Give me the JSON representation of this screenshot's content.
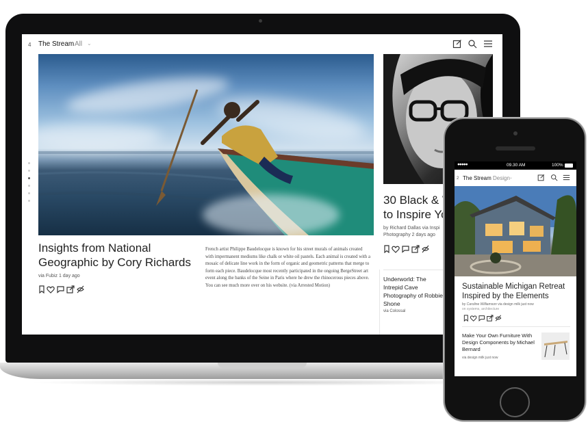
{
  "laptop": {
    "header": {
      "count": "4",
      "title": "The Stream",
      "filter": "All",
      "filter_chevron": "⌄",
      "icons": [
        "compose-icon",
        "search-icon",
        "menu-icon"
      ]
    },
    "pager": {
      "total_dots": 6,
      "active_index": 2
    },
    "featured": {
      "title": "Insights from National Geographic by Cory Richards",
      "meta": "via Fubiz 1 day ago",
      "body": "French artist Philippe Baudelocque is known for his street murals of animals created with impermanent mediums like chalk or white oil pastels. Each animal is created with a mosaic of delicate line work in the form of organic and geometric patterns that merge to form each piece. Baudelocque most recently participated in the ongoing BergeStreet art event along the banks of the Seine in Paris where he drew the rhinocerous pieces above. You can see much more over on his website. (via Arrested Motion)",
      "actions": [
        "bookmark-icon",
        "heart-icon",
        "comment-icon",
        "share-icon",
        "hide-icon"
      ]
    },
    "side_article": {
      "title_line1": "30 Black & W",
      "title_line2": "to Inspire Yo",
      "meta_line1": "by Richard Dallas via Inspi",
      "meta_line2": "Photography 2 days ago",
      "actions": [
        "bookmark-icon",
        "heart-icon",
        "comment-icon",
        "share-icon",
        "hide-icon"
      ]
    },
    "side_article_2": {
      "title": "Underworld: The Intrepid Cave Photography of Robbie Shone",
      "meta": "via Colossal"
    }
  },
  "phone": {
    "status": {
      "signal": "●●●●●",
      "time": "09.30 AM",
      "battery": "100%"
    },
    "header": {
      "count": "2",
      "title": "The Stream",
      "filter": "Design",
      "filter_chevron": "⌄",
      "icons": [
        "compose-icon",
        "search-icon",
        "menu-icon"
      ]
    },
    "featured": {
      "title": "Sustainable Michigan Retreat Inspired by the Elements",
      "meta_prefix": "by ",
      "author": "Caroline Williamson",
      "meta_suffix": " via design milk just now",
      "tags": "on systems, architecture",
      "actions": [
        "bookmark-icon",
        "heart-icon",
        "comment-icon",
        "share-icon",
        "hide-icon"
      ]
    },
    "second": {
      "title": "Make Your Own Furniture With Design Components by Michael Bernard",
      "meta": "via design milk just now"
    }
  },
  "colors": {
    "screen_bg": "#ffffff",
    "text_dark": "#222222",
    "text_meta": "#555555",
    "device_black": "#111111"
  }
}
